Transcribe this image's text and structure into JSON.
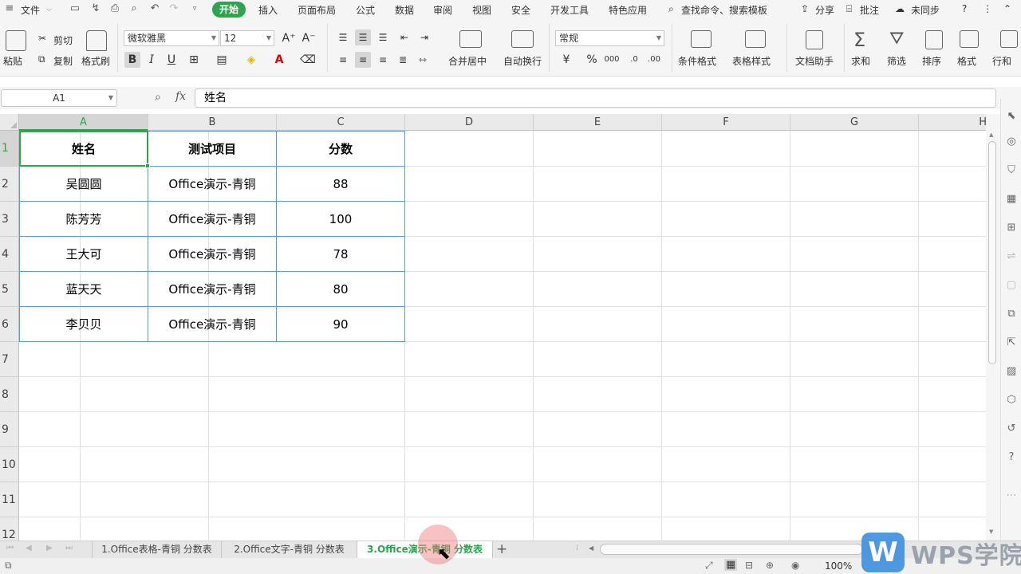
{
  "menubar": {
    "file_label": "文件",
    "tabs": [
      "开始",
      "插入",
      "页面布局",
      "公式",
      "数据",
      "审阅",
      "视图",
      "安全",
      "开发工具",
      "特色应用"
    ],
    "search_label": "查找命令、搜索模板",
    "share_label": "分享",
    "comment_label": "批注",
    "sync_label": "未同步",
    "help_label": "?"
  },
  "ribbon": {
    "paste_label": "粘贴",
    "cut_label": "剪切",
    "copy_label": "复制",
    "format_painter_label": "格式刷",
    "font_name": "微软雅黑",
    "font_size": "12",
    "bold_label": "B",
    "italic_label": "I",
    "underline_label": "U",
    "merge_center_label": "合并居中",
    "auto_wrap_label": "自动换行",
    "number_format": "常规",
    "percent_label": "%",
    "conditional_format_label": "条件格式",
    "table_style_label": "表格样式",
    "doc_assistant_label": "文档助手",
    "sum_label": "求和",
    "filter_label": "筛选",
    "sort_label": "排序",
    "format_label": "格式",
    "row_col_label": "行和"
  },
  "formula_bar": {
    "cell_ref": "A1",
    "fx_label": "fx",
    "content": "姓名"
  },
  "grid": {
    "columns": [
      "A",
      "B",
      "C",
      "D",
      "E",
      "F",
      "G",
      "H"
    ],
    "rows": [
      "1",
      "2",
      "3",
      "4",
      "5",
      "6",
      "7",
      "8",
      "9",
      "10",
      "11",
      "12"
    ],
    "table": [
      [
        "姓名",
        "测试项目",
        "分数"
      ],
      [
        "吴圆圆",
        "Office演示-青铜",
        "88"
      ],
      [
        "陈芳芳",
        "Office演示-青铜",
        "100"
      ],
      [
        "王大可",
        "Office演示-青铜",
        "78"
      ],
      [
        "蓝天天",
        "Office演示-青铜",
        "80"
      ],
      [
        "李贝贝",
        "Office演示-青铜",
        "90"
      ]
    ]
  },
  "sheets": {
    "tabs": [
      "1.Office表格-青铜 分数表",
      "2.Office文字-青铜 分数表",
      "3.Office演示-青铜 分数表"
    ],
    "add_label": "+"
  },
  "status": {
    "zoom": "100%"
  },
  "watermark": {
    "logo": "W",
    "text": "WPS学院"
  },
  "colors": {
    "accent": "#2ea44f",
    "table_border": "#5b9bd5"
  }
}
